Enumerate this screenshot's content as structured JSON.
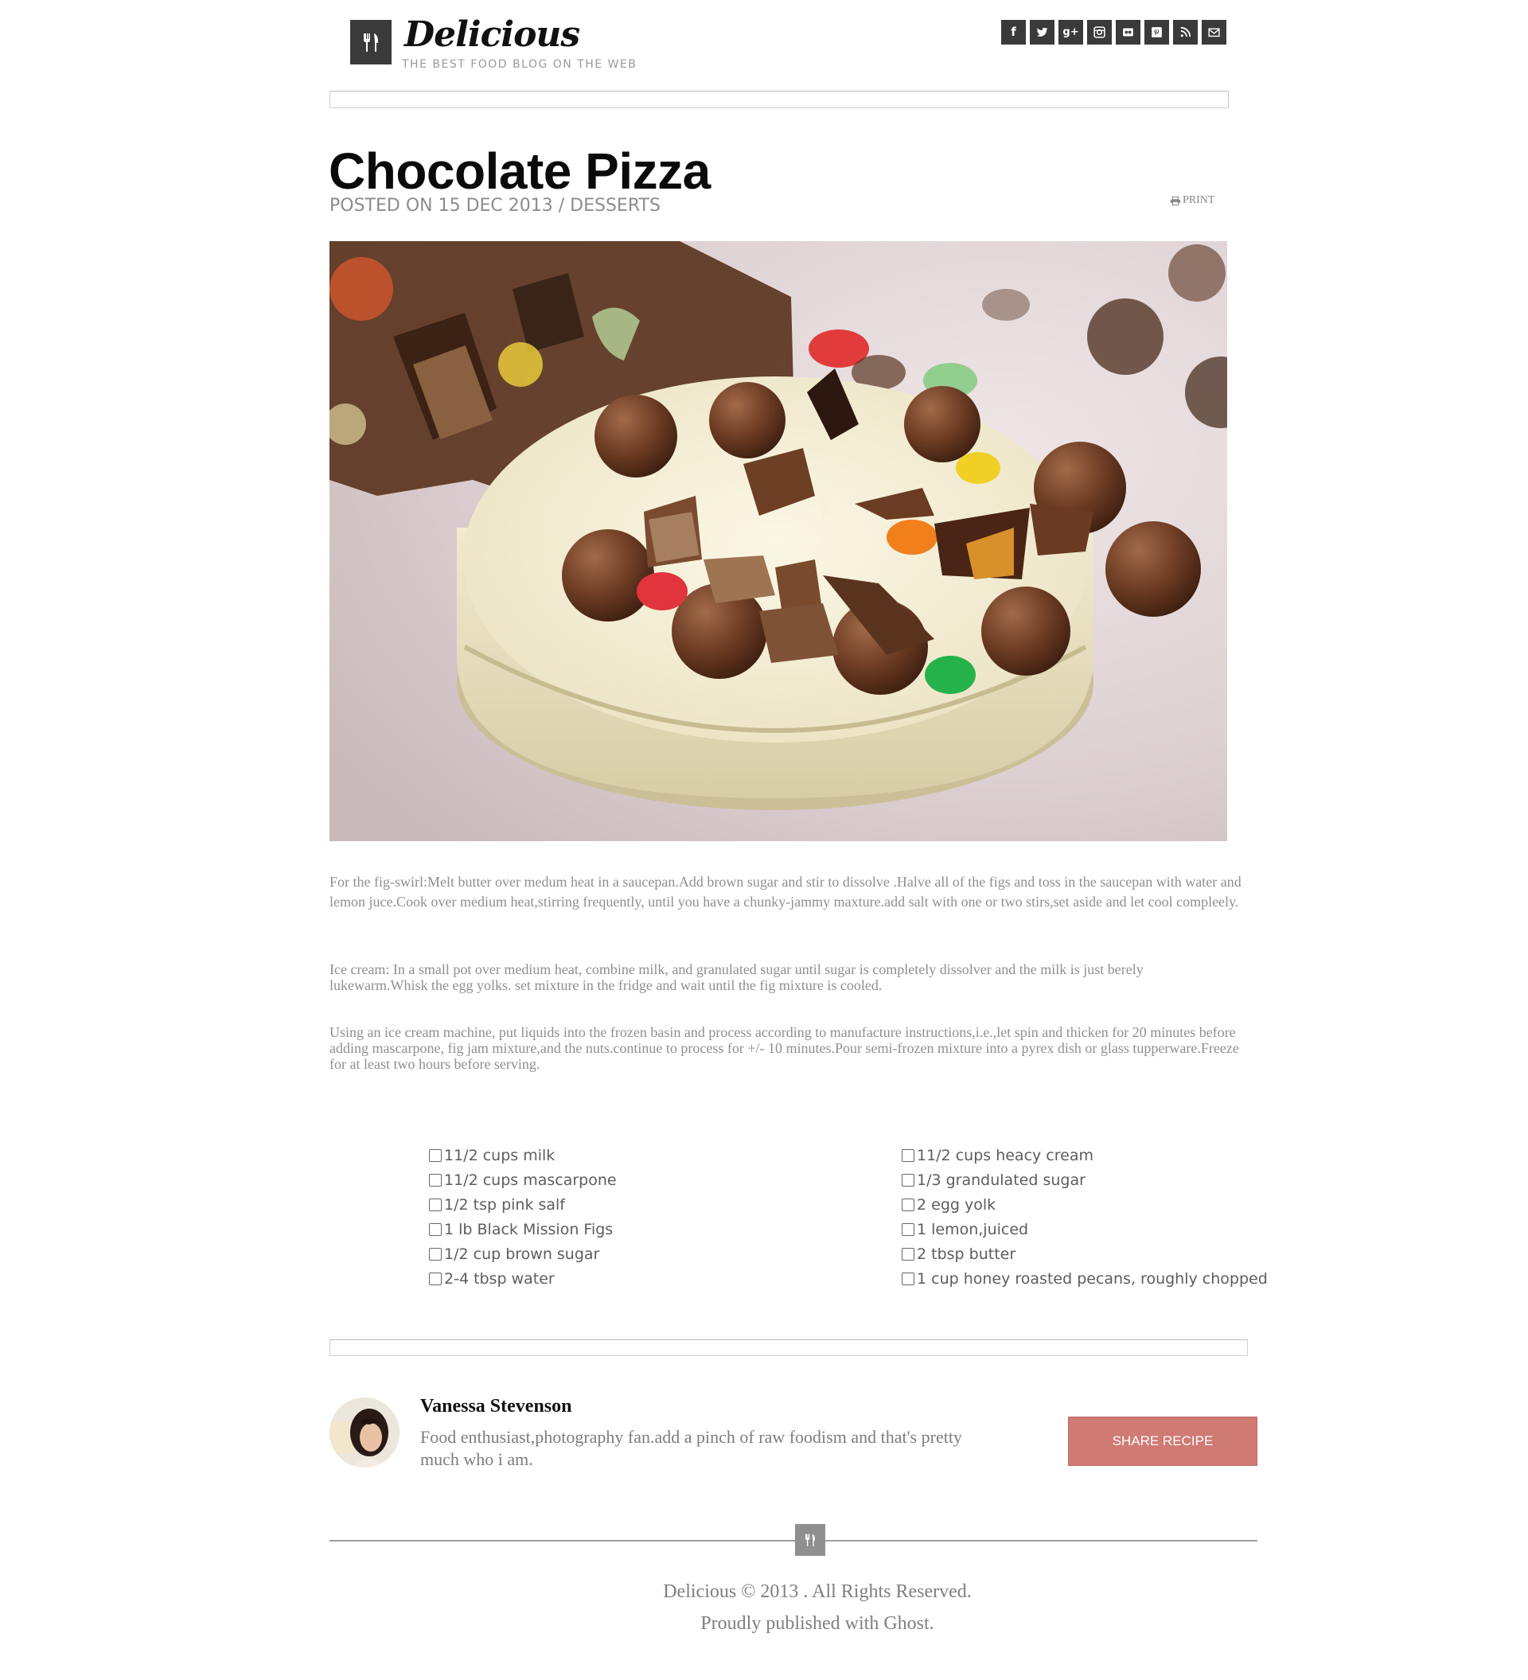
{
  "header": {
    "site_title": "Delicious",
    "tagline": "THE BEST FOOD BLOG ON THE WEB",
    "logo_icon": "fork-knife-icon",
    "social": [
      {
        "name": "facebook-icon",
        "glyph": "f"
      },
      {
        "name": "twitter-icon",
        "glyph": ""
      },
      {
        "name": "google-plus-icon",
        "glyph": "g+"
      },
      {
        "name": "instagram-icon",
        "glyph": ""
      },
      {
        "name": "flickr-icon",
        "glyph": ""
      },
      {
        "name": "pinterest-icon",
        "glyph": ""
      },
      {
        "name": "rss-icon",
        "glyph": ""
      },
      {
        "name": "email-icon",
        "glyph": ""
      }
    ]
  },
  "post": {
    "title": "Chocolate Pizza",
    "meta": "POSTED ON 15 DEC 2013 / DESSERTS",
    "print_label": "PRINT",
    "paragraphs": [
      "For the fig-swirl:Melt butter over medum heat in a saucepan.Add brown sugar and stir to dissolve .Halve all of the figs and toss in the saucepan with water and lemon juce.Cook over medium heat,stirring frequently, until you have a chunky-jammy maxture.add salt with one or two stirs,set aside and let cool compleely.",
      "Ice cream: In a small pot over medium heat, combine milk, and granulated sugar until sugar is completely dissolver and the milk is just berely lukewarm.Whisk the egg yolks. set mixture in the fridge and wait until the fig mixture is cooled.",
      "Using an ice cream machine, put liquids into the frozen basin and process according to manufacture instructions,i.e.,let spin and thicken for 20 minutes before adding mascarpone, fig jam mixture,and the nuts.continue to process for +/- 10 minutes.Pour semi-frozen mixture into a pyrex dish or glass tupperware.Freeze for at least two hours before serving."
    ]
  },
  "ingredients": {
    "left": [
      "11/2 cups milk",
      "11/2 cups mascarpone",
      "1/2 tsp pink salf",
      "1 lb Black Mission Figs",
      "1/2 cup brown sugar",
      "2-4 tbsp water"
    ],
    "right": [
      "11/2 cups heacy cream",
      "1/3 grandulated sugar",
      "2 egg yolk",
      "1 lemon,juiced",
      "2 tbsp butter",
      "1 cup honey roasted pecans, roughly chopped"
    ]
  },
  "author": {
    "name": "Vanessa Stevenson",
    "bio": "Food enthusiast,photography fan.add a pinch of raw foodism and that's pretty much who i am.",
    "share_label": "SHARE RECIPE"
  },
  "footer": {
    "line1": "Delicious © 2013 . All Rights Reserved.",
    "line2": "Proudly published with Ghost."
  },
  "colors": {
    "accent_button": "#cf7a73",
    "icon_bg": "#3a3a3a",
    "footer_icon_bg": "#8f8f8f"
  }
}
